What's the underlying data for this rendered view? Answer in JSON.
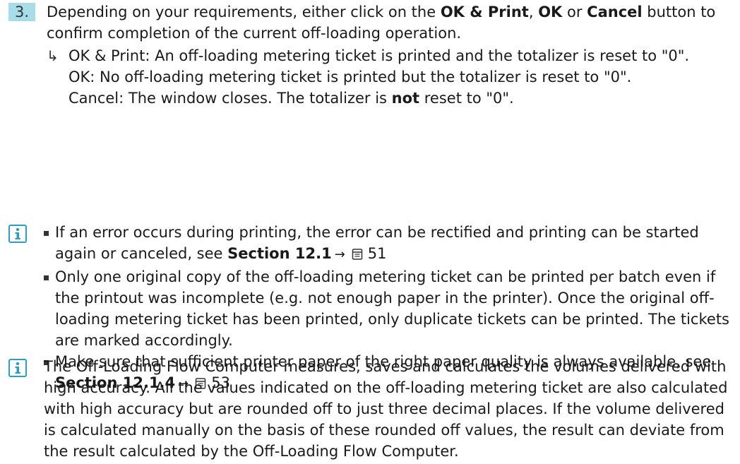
{
  "step": {
    "number": "3.",
    "intro": "Depending on your requirements, either click on the ",
    "btn_ok_print": "OK & Print",
    "sep1": ", ",
    "btn_ok": "OK",
    "sep2": " or ",
    "btn_cancel": "Cancel",
    "tail": " button to confirm completion of the current off-loading operation.",
    "result_arrow": "↳",
    "result_line1": "OK & Print: An off-loading metering ticket is printed and the totalizer is reset to \"0\".",
    "result_line2": "OK: No off-loading metering ticket is printed but the totalizer is reset to \"0\".",
    "result_line3_pre": "Cancel: The window closes. The totalizer is ",
    "result_line3_bold": "not",
    "result_line3_post": " reset to \"0\"."
  },
  "note1": {
    "icon": "info-icon",
    "bullet1_text": "If an error occurs during printing, the error can be rectified and printing can be started again or canceled, see ",
    "bullet1_ref": "Section 12.1",
    "bullet1_arrow": "→",
    "bullet1_page": "51",
    "bullet2_text": "Only one original copy of the off-loading metering ticket can be printed per batch even if the printout was incomplete (e.g. not enough paper in the printer). Once the original off-loading metering ticket has been printed, only duplicate tickets can be printed. The tickets are marked accordingly.",
    "bullet3_text": "Make sure that sufficient printer paper of the right paper quality is always available, see ",
    "bullet3_ref": "Section 12.1.4",
    "bullet3_arrow": "→",
    "bullet3_page": "53"
  },
  "note2": {
    "icon": "info-icon",
    "text": "The Off-Loading Flow Computer measures, saves and calculates the volumes delivered with high accuracy. All the values indicated on the off-loading metering ticket are also calculated with high accuracy but are rounded off to just three decimal places. If the volume delivered is calculated manually on the basis of these rounded off values, the result can deviate from the result calculated by the Off-Loading Flow Computer."
  },
  "colors": {
    "step_badge": "#a6dde8",
    "info_icon": "#2a9fc1",
    "text": "#1a1a1a"
  }
}
